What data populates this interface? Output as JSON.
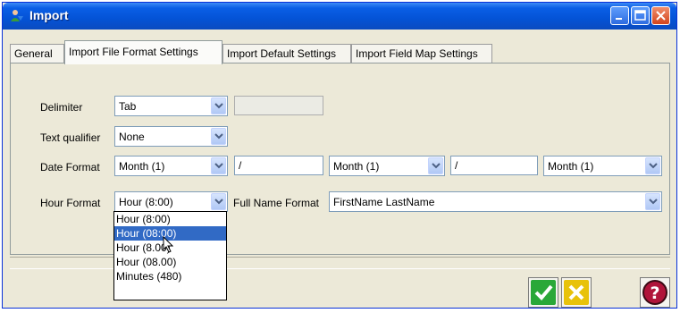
{
  "window": {
    "title": "Import"
  },
  "tabs": [
    {
      "label": "General"
    },
    {
      "label": "Import File Format Settings"
    },
    {
      "label": "Import Default Settings"
    },
    {
      "label": "Import Field Map Settings"
    }
  ],
  "form": {
    "delimiter": {
      "label": "Delimiter",
      "value": "Tab"
    },
    "text_qualifier": {
      "label": "Text qualifier",
      "value": "None"
    },
    "date_format": {
      "label": "Date Format",
      "part1": "Month (1)",
      "sep1": "/",
      "part2": "Month (1)",
      "sep2": "/",
      "part3": "Month (1)"
    },
    "hour_format": {
      "label": "Hour Format",
      "value": "Hour (8:00)"
    },
    "full_name_format": {
      "label": "Full Name Format",
      "value": "FirstName LastName"
    }
  },
  "hour_dropdown": {
    "options": [
      "Hour (8:00)",
      "Hour (08:00)",
      "Hour (8.00)",
      "Hour (08.00)",
      "Minutes (480)"
    ],
    "highlighted_index": 1
  },
  "colors": {
    "accent": "#316ac5",
    "ok": "#2aa838",
    "cancel": "#e8c20a",
    "help": "#b0143a"
  },
  "icons": [
    "app-icon",
    "minimize-icon",
    "maximize-icon",
    "close-icon",
    "checkmark-icon",
    "x-icon",
    "help-icon",
    "chevron-down-icon",
    "mouse-cursor-icon"
  ]
}
